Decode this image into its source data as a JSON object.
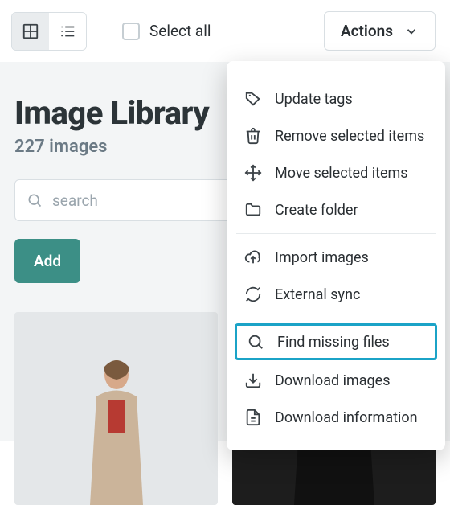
{
  "toolbar": {
    "select_all_label": "Select all",
    "actions_label": "Actions"
  },
  "page": {
    "title": "Image Library",
    "count": "227 images",
    "search_placeholder": "search",
    "add_label": "Add"
  },
  "menu": {
    "items": [
      {
        "label": "Update tags"
      },
      {
        "label": "Remove selected items"
      },
      {
        "label": "Move selected items"
      },
      {
        "label": "Create folder"
      },
      {
        "label": "Import images"
      },
      {
        "label": "External sync"
      },
      {
        "label": "Find missing files"
      },
      {
        "label": "Download images"
      },
      {
        "label": "Download information"
      }
    ]
  },
  "colors": {
    "teal": "#3c8f86",
    "highlight": "#1ba3c7"
  }
}
